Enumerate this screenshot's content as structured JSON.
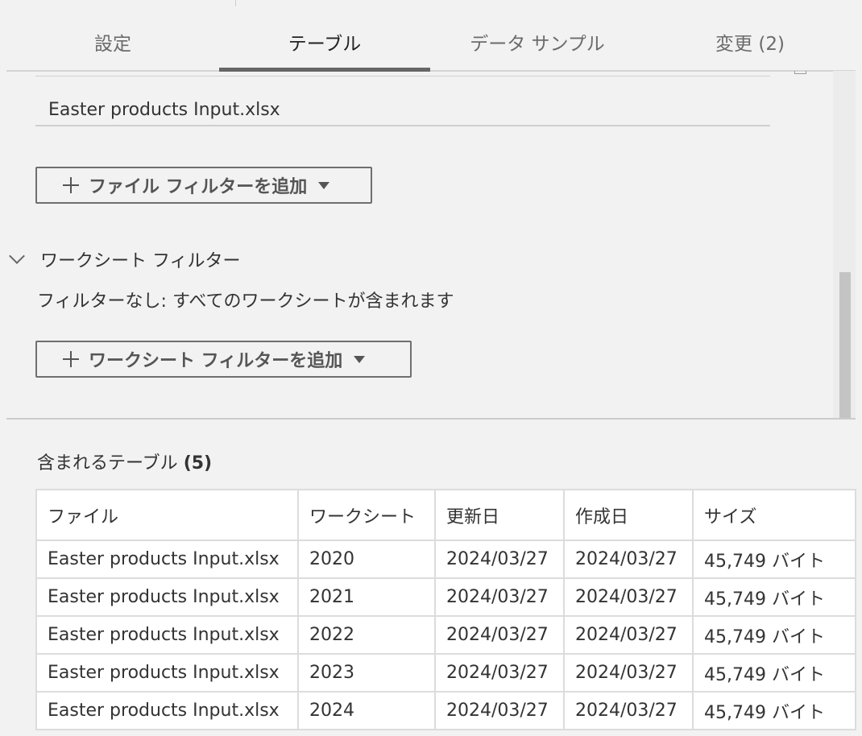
{
  "tabs": [
    {
      "label": "設定"
    },
    {
      "label": "テーブル"
    },
    {
      "label": "データ サンプル"
    },
    {
      "label": "変更 (2)"
    }
  ],
  "active_tab": "テーブル",
  "file_filter": {
    "file_name": "Easter products Input.xlsx",
    "add_button_label": "ファイル フィルターを追加"
  },
  "worksheet_filter": {
    "title": "ワークシート フィルター",
    "description": "フィルターなし: すべてのワークシートが含まれます",
    "add_button_label": "ワークシート フィルターを追加"
  },
  "included_tables": {
    "title": "含まれるテーブル",
    "count": "(5)",
    "columns": [
      "ファイル",
      "ワークシート",
      "更新日",
      "作成日",
      "サイズ"
    ],
    "rows": [
      [
        "Easter products Input.xlsx",
        "2020",
        "2024/03/27",
        "2024/03/27",
        "45,749 バイト"
      ],
      [
        "Easter products Input.xlsx",
        "2021",
        "2024/03/27",
        "2024/03/27",
        "45,749 バイト"
      ],
      [
        "Easter products Input.xlsx",
        "2022",
        "2024/03/27",
        "2024/03/27",
        "45,749 バイト"
      ],
      [
        "Easter products Input.xlsx",
        "2023",
        "2024/03/27",
        "2024/03/27",
        "45,749 バイト"
      ],
      [
        "Easter products Input.xlsx",
        "2024",
        "2024/03/27",
        "2024/03/27",
        "45,749 バイト"
      ]
    ]
  },
  "icons": {
    "add": "plus-icon",
    "dropdown": "caret-down-icon",
    "collapse": "chevron-down-icon"
  },
  "colors": {
    "background": "#f2f2f2",
    "active_tab_indicator": "#666666",
    "table_background": "#ffffff"
  }
}
